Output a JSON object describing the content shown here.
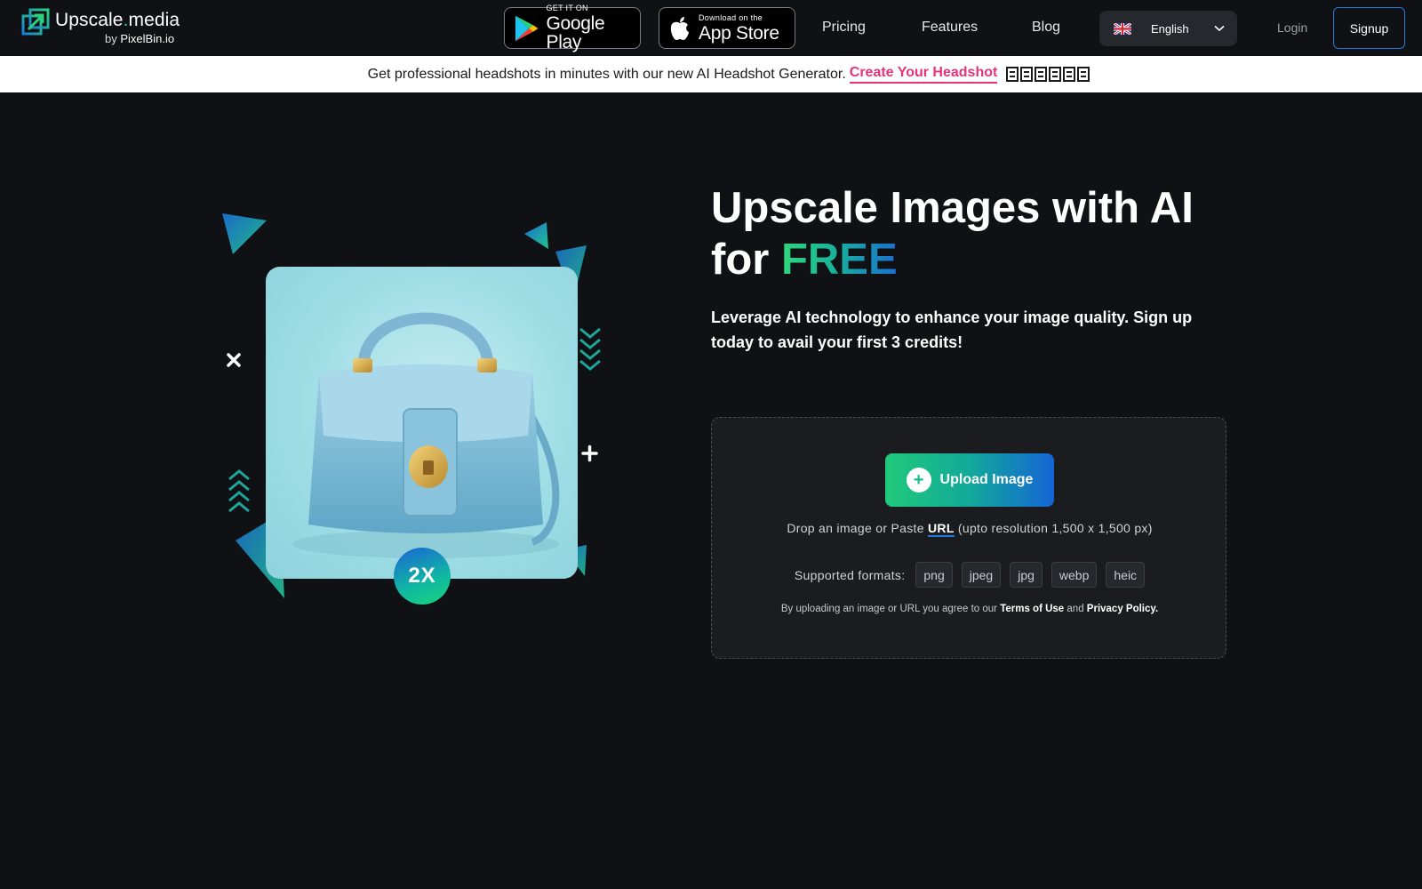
{
  "nav": {
    "logo": {
      "word_main": "Upscale",
      "word_dot": ".",
      "word_tail": "media",
      "by": "by",
      "by_brand": "PixelBin.io"
    },
    "google_play": {
      "small": "GET IT ON",
      "big": "Google Play"
    },
    "app_store": {
      "small": "Download on the",
      "big": "App Store"
    },
    "links": {
      "pricing": "Pricing",
      "features": "Features",
      "blog": "Blog"
    },
    "language": {
      "selected": "English"
    },
    "login": "Login",
    "signup": "Signup"
  },
  "promo": {
    "text": "Get professional headshots in minutes with our new AI Headshot Generator.",
    "link": "Create Your Headshot"
  },
  "hero": {
    "badge": "2X",
    "title_line1": "Upscale Images with AI",
    "title_for": "for",
    "title_free": "FREE",
    "subtitle": "Leverage AI technology to enhance your image quality. Sign up today to avail your first 3 credits!"
  },
  "upload": {
    "button": "Upload Image",
    "drop_prefix": "Drop an image or Paste",
    "drop_url": "URL",
    "drop_suffix": "(upto resolution 1,500 x 1,500 px)",
    "formats_label": "Supported formats:",
    "formats": [
      "png",
      "jpeg",
      "jpg",
      "webp",
      "heic"
    ],
    "terms_prefix": "By uploading an image or URL you agree to our",
    "terms_link": "Terms of Use",
    "terms_and": "and",
    "privacy_link": "Privacy Policy."
  },
  "colors": {
    "background": "#0f1114",
    "accent_green": "#21c97a",
    "accent_blue": "#1565d6",
    "promo_pink": "#e5337a"
  }
}
